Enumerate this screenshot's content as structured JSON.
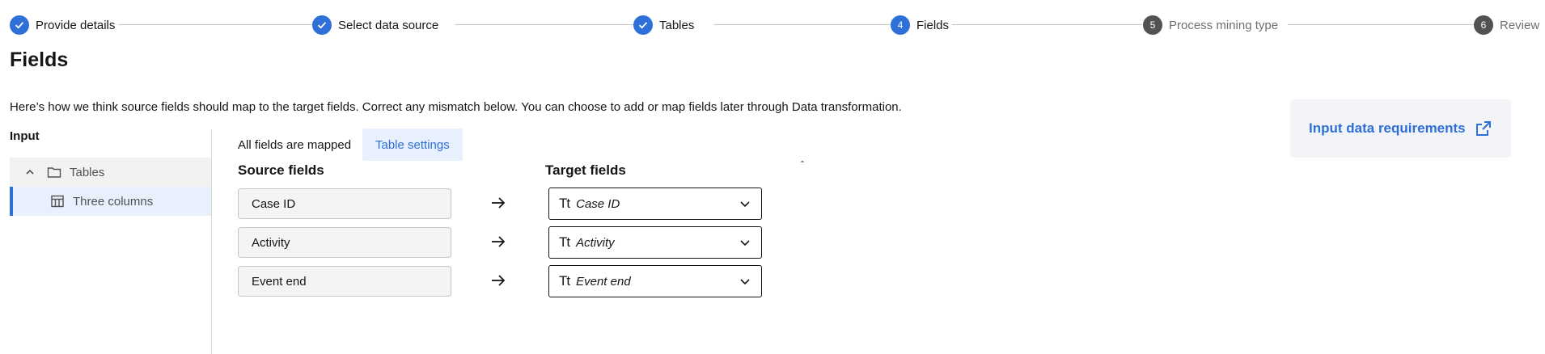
{
  "stepper": {
    "steps": [
      {
        "label": "Provide details",
        "status": "done",
        "number": ""
      },
      {
        "label": "Select data source",
        "status": "done",
        "number": ""
      },
      {
        "label": "Tables",
        "status": "done",
        "number": ""
      },
      {
        "label": "Fields",
        "status": "current",
        "number": "4"
      },
      {
        "label": "Process mining type",
        "status": "todo",
        "number": "5"
      },
      {
        "label": "Review",
        "status": "todo",
        "number": "6"
      }
    ]
  },
  "page": {
    "title": "Fields",
    "description": "Here’s how we think source fields should map to the target fields. Correct any mismatch below. You can choose to add or map fields later through Data transformation."
  },
  "requirements": {
    "link_label": "Input data requirements",
    "icon": "external-link-icon"
  },
  "sidebar": {
    "heading": "Input",
    "tree": {
      "parent_label": "Tables",
      "child_label": "Three columns"
    }
  },
  "tabs": {
    "mapped_label": "All fields are mapped",
    "settings_label": "Table settings"
  },
  "mapping": {
    "source_heading": "Source fields",
    "target_heading": "Target fields",
    "rows": [
      {
        "source": "Case ID",
        "target": "Case ID"
      },
      {
        "source": "Activity",
        "target": "Activity"
      },
      {
        "source": "Event end",
        "target": "Event end"
      }
    ],
    "type_icon_text": "Tt"
  },
  "colors": {
    "accent": "#2e6fd8",
    "step_todo": "#525252",
    "selected_bg": "#e8effd",
    "card_bg": "#f2f4f8"
  }
}
